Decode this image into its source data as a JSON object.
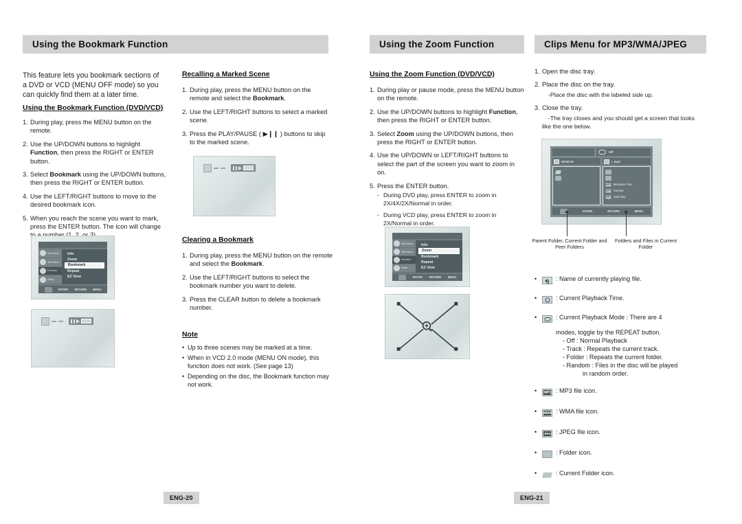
{
  "document": {
    "type": "dvd-player-user-manual-spread",
    "left_page_number": "ENG-20",
    "right_page_number": "ENG-21"
  },
  "sections": {
    "bookmark": {
      "title": "Using the Bookmark Function",
      "intro": "This feature lets you bookmark sections of a DVD or VCD (MENU OFF mode) so you can quickly find them at a later time.",
      "sub_title": "Using the Bookmark Function (DVD/VCD)",
      "steps": [
        "During play, press the MENU button on the remote.",
        "Use the UP/DOWN buttons to highlight Function, then press the RIGHT or ENTER button.",
        "Select Bookmark using the UP/DOWN buttons, then press the RIGHT or ENTER button.",
        "Use the LEFT/RIGHT buttons to move to the desired bookmark icon.",
        "When you reach the scene you want to mark, press the ENTER button. The icon will change to a number (1, 2, or 3)."
      ]
    },
    "recalling": {
      "title": "Recalling a Marked Scene",
      "steps": [
        "During play, press the MENU button on the remote and select the Bookmark.",
        "Use the LEFT/RIGHT buttons to select a marked scene.",
        "Press the PLAY/PAUSE ( ▶❙❙ ) buttons to skip to the marked scene."
      ]
    },
    "clearing": {
      "title": "Clearing a Bookmark",
      "steps": [
        "During play, press the MENU button on the remote and select the Bookmark.",
        "Use the LEFT/RIGHT buttons to select the bookmark number you want to delete.",
        "Press the CLEAR button to delete a bookmark number."
      ]
    },
    "note": {
      "title": "Note",
      "items": [
        "Up to three scenes may be marked at a time.",
        "When in VCD 2.0 mode (MENU ON mode), this function does not work. (See page 13)",
        "Depending on the disc, the Bookmark function may not work."
      ]
    },
    "zoom": {
      "title": "Using the Zoom Function",
      "sub_title": "Using the Zoom Function (DVD/VCD)",
      "steps": [
        "During play or pause mode, press the MENU button on the remote.",
        "Use the UP/DOWN buttons to highlight Function, then press the RIGHT or ENTER button.",
        "Select Zoom using the UP/DOWN buttons, then press the RIGHT or ENTER button.",
        "Use the UP/DOWN or LEFT/RIGHT buttons to select the part of the screen you want to zoom in on.",
        "Press the ENTER button."
      ],
      "substeps": [
        "During DVD play, press ENTER to zoom in 2X/4X/2X/Normal in order.",
        "During VCD play, press ENTER to zoom in 2X/Normal in order."
      ]
    },
    "clips": {
      "title": "Clips Menu for MP3/WMA/JPEG",
      "steps": [
        "Open the disc tray.",
        "Place the disc on the tray.",
        "Close the tray."
      ],
      "substeps": [
        "Place the disc with the labeled side up.",
        "The tray closes and you should get a screen that looks like the one below."
      ],
      "caption_left": "Parent Folder, Current Folder and Peer Folders",
      "caption_right": "Folders and Files in Current Folder",
      "legend": [
        {
          "icon": "speaker-file-icon",
          "text": ": Name of currently playing file."
        },
        {
          "icon": "clock-icon",
          "text": ": Current Playback Time."
        },
        {
          "icon": "repeat-icon",
          "text": ": Current Playback Mode : There are 4",
          "cont": "modes, toggle by the REPEAT button."
        },
        {
          "icon": "mp3-file-icon",
          "text": ": MP3 file icon.",
          "tag": "MP3"
        },
        {
          "icon": "wma-file-icon",
          "text": ": WMA file icon.",
          "tag": "WMA"
        },
        {
          "icon": "jpeg-file-icon",
          "text": ": JPEG file icon.",
          "tag": "JPEG"
        },
        {
          "icon": "folder-icon",
          "text": ": Folder icon."
        },
        {
          "icon": "current-folder-icon",
          "text": ": Current Folder icon."
        }
      ],
      "repeat_modes": [
        "- Off : Normal Playback",
        "- Track : Repeats the current track.",
        "- Folder : Repeats the current folder.",
        "- Random : Files in the disc will be played",
        "in random order."
      ]
    }
  },
  "osd_menu": {
    "sidebar": [
      {
        "label": "Disk Menu",
        "icon": "disc-icon"
      },
      {
        "label": "Title Menu",
        "icon": "disc-icon"
      },
      {
        "label": "Function",
        "icon": "function-icon"
      },
      {
        "label": "Setup",
        "icon": "gear-icon"
      }
    ],
    "items": [
      "Info",
      "Zoom",
      "Bookmark",
      "Repeat",
      "EZ View"
    ],
    "bookmark_selected": "Bookmark",
    "zoom_selected": "Zoom",
    "footer": [
      "ENTER",
      "RETURN",
      "MENU"
    ]
  },
  "clips_screen": {
    "mode_value": "Off",
    "time_value": "00:00:23",
    "folder_value": "I_mp3",
    "files": [
      {
        "type": "MP3",
        "name": "Because You"
      },
      {
        "type": "MP3",
        "name": "Genius"
      },
      {
        "type": "MP3",
        "name": "Sad Day"
      }
    ],
    "footer": [
      "ENTER",
      "RETURN",
      "MENU"
    ]
  }
}
